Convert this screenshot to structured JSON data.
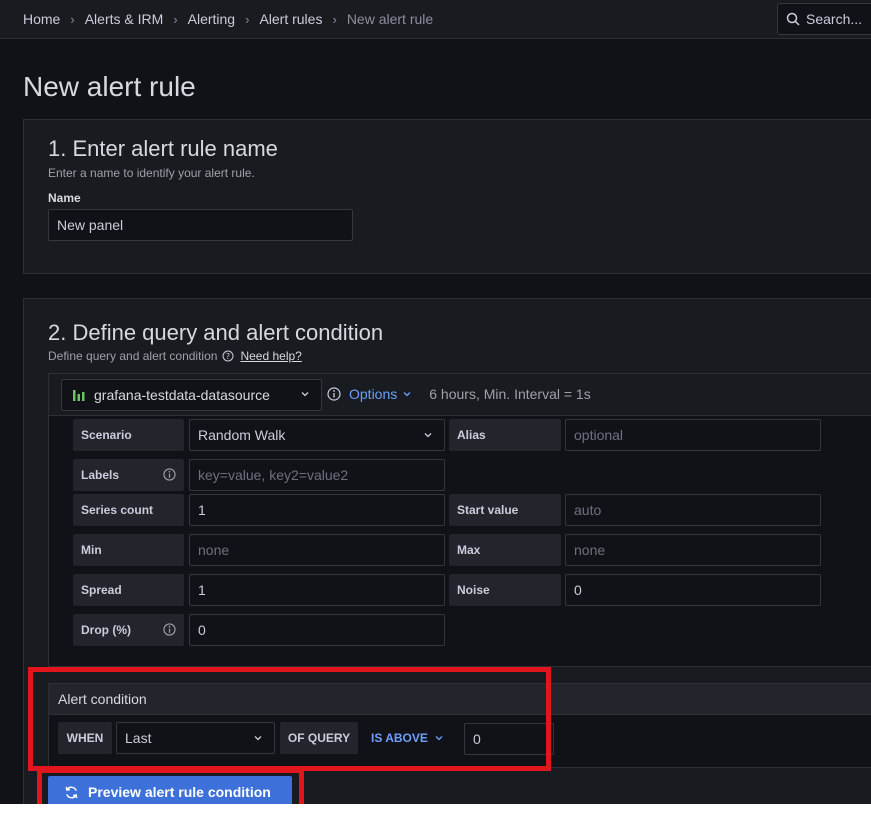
{
  "breadcrumb": {
    "items": [
      "Home",
      "Alerts & IRM",
      "Alerting",
      "Alert rules",
      "New alert rule"
    ]
  },
  "search": {
    "placeholder": "Search..."
  },
  "page": {
    "title": "New alert rule"
  },
  "section1": {
    "heading": "1. Enter alert rule name",
    "description": "Enter a name to identify your alert rule.",
    "name_label": "Name",
    "name_value": "New panel"
  },
  "section2": {
    "heading": "2. Define query and alert condition",
    "description": "Define query and alert condition",
    "help_link": "Need help?",
    "query": {
      "datasource": "grafana-testdata-datasource",
      "options_label": "Options",
      "options_meta": "6 hours, Min. Interval = 1s",
      "fields": {
        "scenario_label": "Scenario",
        "scenario_value": "Random Walk",
        "alias_label": "Alias",
        "alias_placeholder": "optional",
        "labels_label": "Labels",
        "labels_placeholder": "key=value, key2=value2",
        "series_count_label": "Series count",
        "series_count_value": "1",
        "start_value_label": "Start value",
        "start_value_placeholder": "auto",
        "min_label": "Min",
        "min_placeholder": "none",
        "max_label": "Max",
        "max_placeholder": "none",
        "spread_label": "Spread",
        "spread_value": "1",
        "noise_label": "Noise",
        "noise_value": "0",
        "drop_label": "Drop (%)",
        "drop_value": "0"
      }
    },
    "alert_condition": {
      "heading": "Alert condition",
      "when": "WHEN",
      "reducer": "Last",
      "of_query": "OF QUERY",
      "evaluator": "IS ABOVE",
      "threshold": "0"
    },
    "preview_button": "Preview alert rule condition"
  },
  "colors": {
    "accent": "#6e9fff",
    "primary_button": "#3d71d9",
    "highlight": "#e0161c"
  }
}
